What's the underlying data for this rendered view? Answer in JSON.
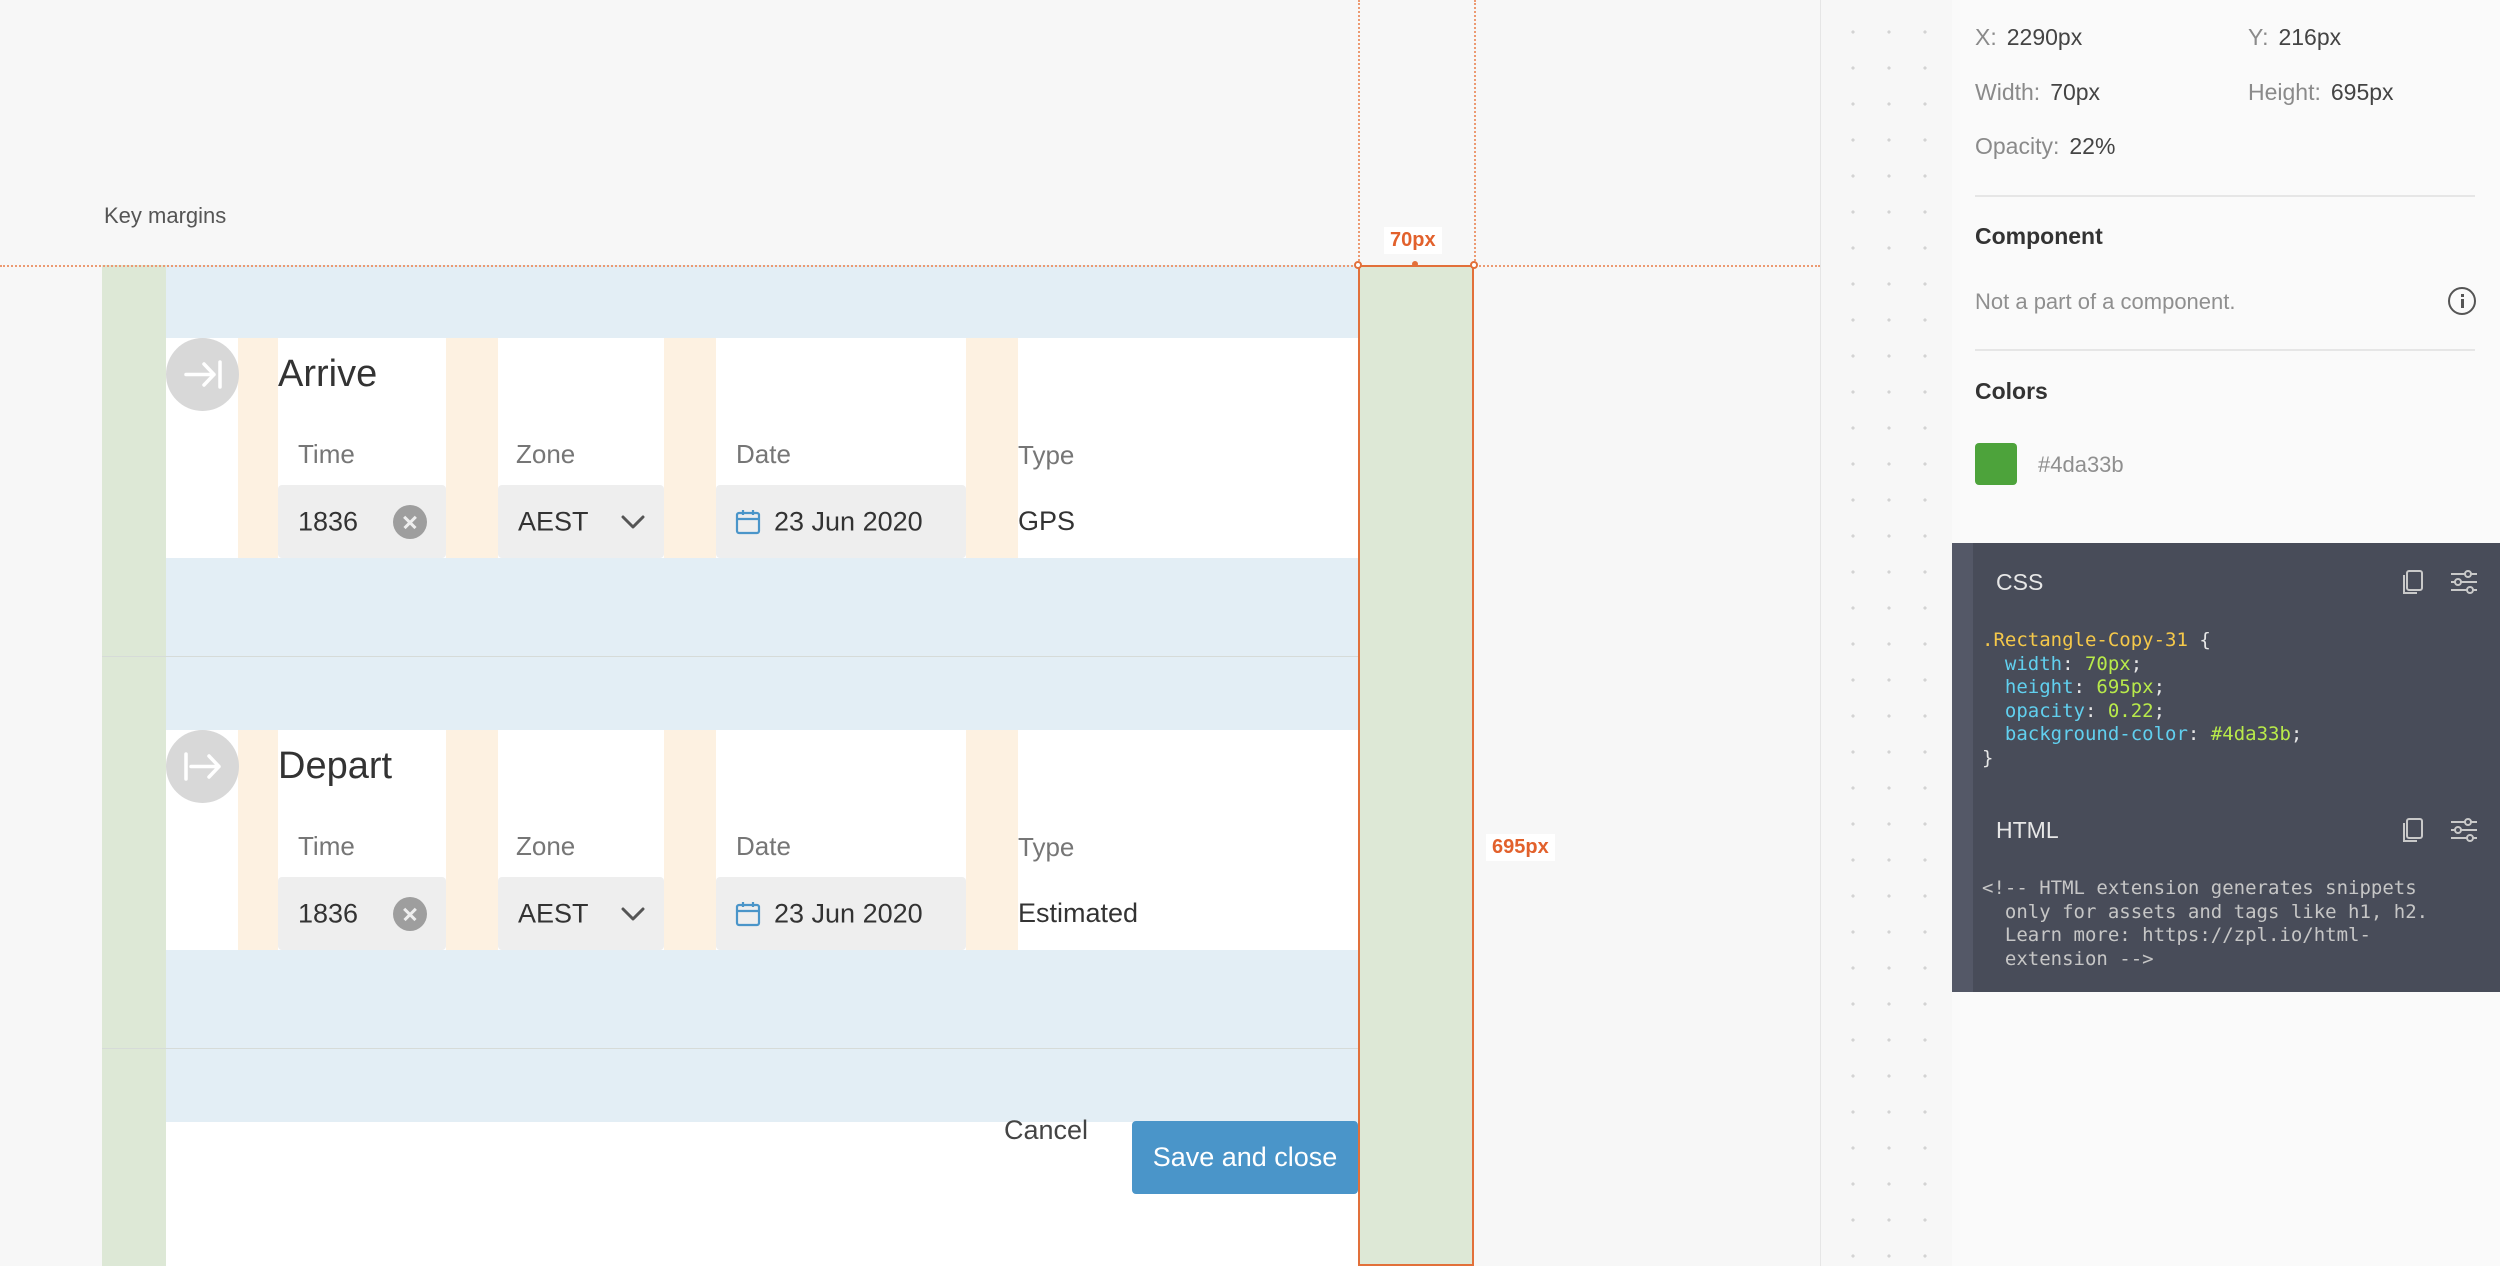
{
  "canvas": {
    "frame_label": "Key margins",
    "arrive": {
      "title": "Arrive",
      "time_label": "Time",
      "time_value": "1836",
      "zone_label": "Zone",
      "zone_value": "AEST",
      "date_label": "Date",
      "date_value": "23 Jun 2020",
      "type_label": "Type",
      "type_value": "GPS"
    },
    "depart": {
      "title": "Depart",
      "time_label": "Time",
      "time_value": "1836",
      "zone_label": "Zone",
      "zone_value": "AEST",
      "date_label": "Date",
      "date_value": "23 Jun 2020",
      "type_label": "Type",
      "type_value": "Estimated"
    },
    "cancel_label": "Cancel",
    "save_label": "Save and close",
    "width_measure": "70px",
    "height_measure": "695px"
  },
  "inspector": {
    "x_label": "X:",
    "x_value": "2290px",
    "y_label": "Y:",
    "y_value": "216px",
    "width_label": "Width:",
    "width_value": "70px",
    "height_label": "Height:",
    "height_value": "695px",
    "opacity_label": "Opacity:",
    "opacity_value": "22%",
    "component_heading": "Component",
    "component_text": "Not a part of a component.",
    "colors_heading": "Colors",
    "color_hex": "#4da33b",
    "css_title": "CSS",
    "css": {
      "selector": ".Rectangle-Copy-31",
      "open": " {",
      "close": "}",
      "decls": [
        {
          "prop": "width",
          "val": "70px"
        },
        {
          "prop": "height",
          "val": "695px"
        },
        {
          "prop": "opacity",
          "val": "0.22"
        },
        {
          "prop": "background-color",
          "val": "#4da33b"
        }
      ]
    },
    "html_title": "HTML",
    "html_comment": "<!-- HTML extension generates snippets\n  only for assets and tags like h1, h2.\n  Learn more: https://zpl.io/html-\n  extension -->"
  },
  "colors": {
    "accent": "#4a95c9",
    "measure": "#e2612c",
    "swatch": "#4da33b"
  }
}
